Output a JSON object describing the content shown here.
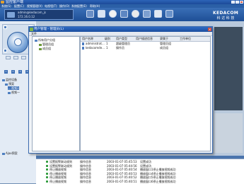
{
  "app": {
    "title": "监控客户端"
  },
  "menu": [
    "系统(S)",
    "配置(C)",
    "视频管理(V)",
    "电视墙(T)",
    "操作(O)",
    "系统配置(E)",
    "帮助(H)"
  ],
  "header": {
    "user": "admin@kedacom_js",
    "ip": "172.16.0.12",
    "brand_en": "KEDACOM",
    "brand_cn": "科 达 科 技"
  },
  "left_panel": {
    "ptz_numbers": [
      "1",
      "2",
      "3",
      "4"
    ],
    "tree": [
      "监控设备",
      "预案",
      "视频1",
      "视频一"
    ],
    "bottom_item": "Ajax预案"
  },
  "dialog": {
    "title": "用户管理 - 管理员(L)",
    "menu": "文件",
    "tree": [
      "所有用户分组",
      "管理员组",
      "成员组"
    ],
    "columns": [
      "用户名称",
      "级别",
      "用户类型",
      "用户描述信息",
      "隶属于",
      "工作单位"
    ],
    "rows": [
      [
        "administrat...",
        "1",
        "超级管理员",
        "",
        "管理员组",
        ""
      ],
      [
        "kedacomde...",
        "1",
        "操作员",
        "",
        "成员组",
        ""
      ]
    ]
  },
  "log": {
    "rows": [
      [
        "设置报警联动规则",
        "操作信息",
        "2003-01-07 05:45:53",
        "设置成功"
      ],
      [
        "设置报警联动规则",
        "操作信息",
        "2003-01-07 05:44:56",
        "设置成功"
      ],
      [
        "停止播放视频",
        "操作信息",
        "2003-01-07 05:40:54",
        "播放窗口1停止播放视频成功"
      ],
      [
        "停止播放视频",
        "操作信息",
        "2003-01-07 05:40:53",
        "播放窗口4停止播放视频成功"
      ],
      [
        "停止播放视频",
        "操作信息",
        "2003-01-07 05:40:52",
        "播放窗口5停止播放视频成功"
      ],
      [
        "停止播放视频",
        "操作信息",
        "2003-01-07 05:40:51",
        "播放窗口6停止播放视频成功"
      ]
    ]
  },
  "colors": {
    "titlebar": "#1b4a98",
    "header": "#2b5fa6",
    "dialog_title": "#2f6bc4",
    "accent_green": "#2c9a3a"
  }
}
